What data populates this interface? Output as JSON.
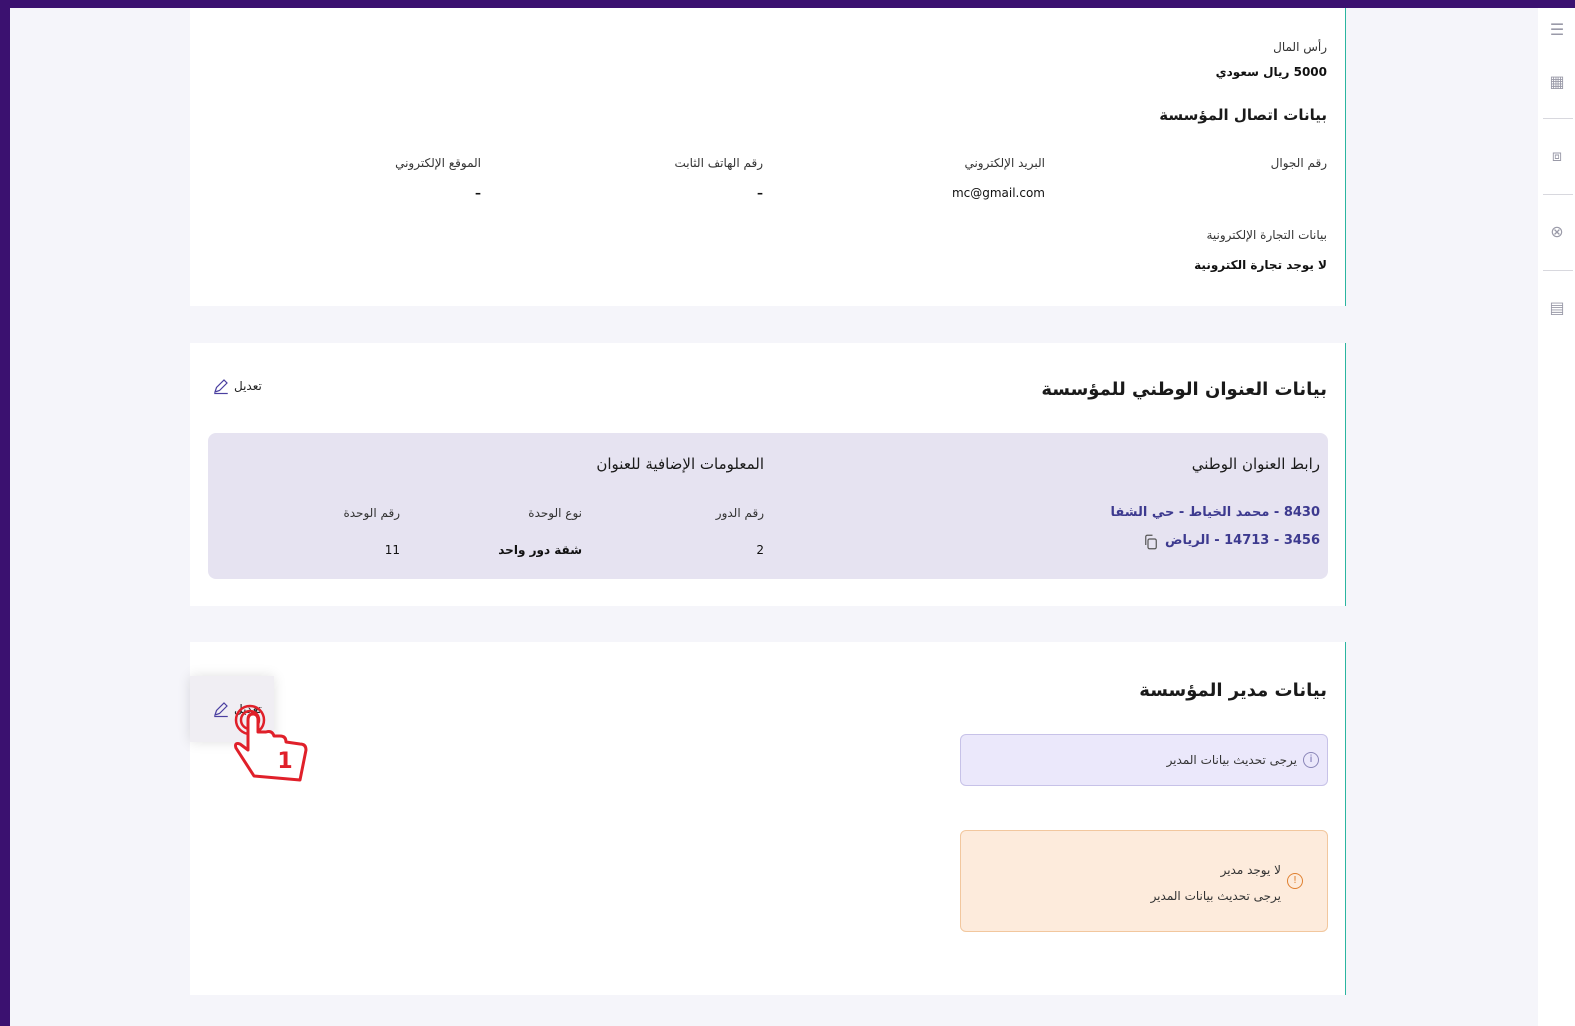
{
  "company": {
    "capital_label": "رأس المال",
    "capital_value": "5000 ريال سعودي",
    "contact_title": "بيانات اتصال المؤسسة",
    "mobile_label": "رقم الجوال",
    "email_label": "البريد الإلكتروني",
    "email_value": "mc@gmail.com",
    "phone_label": "رقم الهاتف الثابت",
    "phone_value": "–",
    "website_label": "الموقع الإلكتروني",
    "website_value": "–",
    "ecommerce_label": "بيانات التجارة الإلكترونية",
    "ecommerce_value": "لا يوجد تجارة الكترونية"
  },
  "address": {
    "title": "بيانات العنوان الوطني للمؤسسة",
    "edit_label": "تعديل",
    "link_title": "رابط العنوان الوطني",
    "link_line1": "8430 - محمد الخياط - حي الشفا",
    "link_line2": "3456 - 14713 - الرياض",
    "extra_title": "المعلومات الإضافية للعنوان",
    "floor_label": "رقم الدور",
    "floor_value": "2",
    "unit_type_label": "نوع الوحدة",
    "unit_type_value": "شقة دور واحد",
    "unit_no_label": "رقم الوحدة",
    "unit_no_value": "11"
  },
  "manager": {
    "title": "بيانات مدير المؤسسة",
    "edit_label": "تعديل",
    "notice_info": "يرجى تحديث بيانات المدير",
    "notice_warn_title": "لا يوجد مدير",
    "notice_warn_body": "يرجى تحديث بيانات المدير",
    "step_number": "1"
  },
  "colors": {
    "frame": "#3b1170",
    "accent_line": "#2bb5a0",
    "link": "#3d3a8f",
    "cursor": "#e0202a"
  }
}
